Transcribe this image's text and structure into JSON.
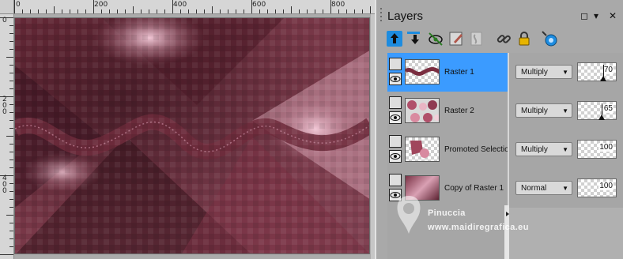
{
  "rulers": {
    "horizontal_labels": [
      "0",
      "200",
      "400",
      "600",
      "800"
    ],
    "vertical_labels": [
      "0",
      "2\n0\n0",
      "4\n0\n0"
    ]
  },
  "panel": {
    "title": "Layers",
    "window_buttons": {
      "restore": "◻",
      "menu": "▾",
      "close": "✕"
    }
  },
  "toolbar": {
    "tools": [
      {
        "name": "move-layer-up-icon",
        "color": "#1d8ce0"
      },
      {
        "name": "move-layer-down-icon",
        "color": "#1d8ce0"
      },
      {
        "name": "toggle-visibility-icon",
        "color": "#2a7a22"
      },
      {
        "name": "edit-icon",
        "color": "#b0564a"
      },
      {
        "name": "link-icon",
        "color": "#9a9a9a"
      },
      {
        "name": "chain-icon",
        "color": "#444444"
      },
      {
        "name": "lock-icon",
        "color": "#e7b400"
      },
      {
        "name": "properties-icon",
        "color": "#1d8ce0"
      }
    ]
  },
  "layers": [
    {
      "name": "Raster 1",
      "blend": "Multiply",
      "opacity": "70",
      "opacity_fraction": 0.7,
      "selected": true,
      "thumb": "wave"
    },
    {
      "name": "Raster 2",
      "blend": "Multiply",
      "opacity": "65",
      "opacity_fraction": 0.65,
      "selected": false,
      "thumb": "floral"
    },
    {
      "name": "Promoted Selection",
      "blend": "Multiply",
      "opacity": "100",
      "opacity_fraction": 1.0,
      "selected": false,
      "thumb": "blob"
    },
    {
      "name": "Copy of Raster 1",
      "blend": "Normal",
      "opacity": "100",
      "opacity_fraction": 1.0,
      "selected": false,
      "thumb": "pink"
    }
  ],
  "watermark": {
    "name": "Pinuccia",
    "url": "www.maidiregrafica.eu"
  },
  "colors": {
    "selection": "#3b9bff",
    "canvas_dark": "#5a2230",
    "canvas_light": "#d8a3b4"
  }
}
